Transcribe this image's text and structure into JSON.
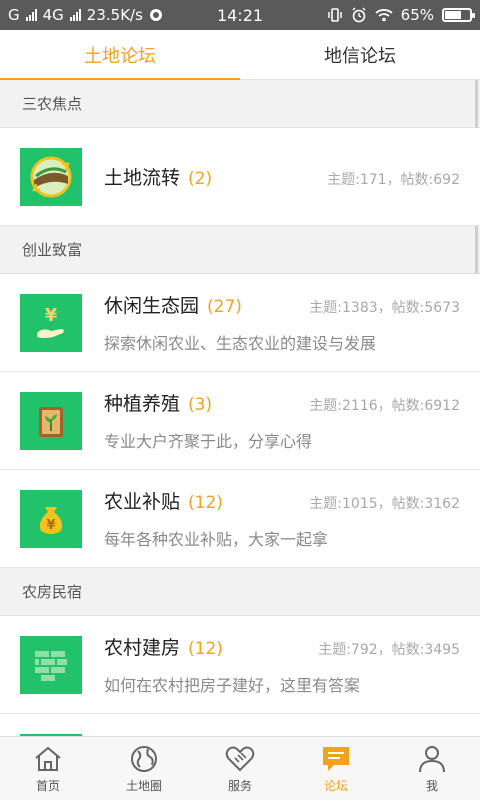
{
  "status": {
    "carrier1": "G",
    "carrier2": "4G",
    "speed": "23.5K/s",
    "time": "14:21",
    "battery": "65%",
    "battery_level": 0.65
  },
  "tabs": [
    {
      "label": "土地论坛",
      "active": true
    },
    {
      "label": "地信论坛",
      "active": false
    }
  ],
  "sections": [
    {
      "title": "三农焦点",
      "items": [
        {
          "name": "土地流转",
          "count": "(2)",
          "stats": "主题:171，帖数:692",
          "desc": "",
          "icon": "land-transfer-icon"
        }
      ]
    },
    {
      "title": "创业致富",
      "items": [
        {
          "name": "休闲生态园",
          "count": "(27)",
          "stats": "主题:1383，帖数:5673",
          "desc": "探索休闲农业、生态农业的建设与发展",
          "icon": "yuan-hand-icon"
        },
        {
          "name": "种植养殖",
          "count": "(3)",
          "stats": "主题:2116，帖数:6912",
          "desc": "专业大户齐聚于此，分享心得",
          "icon": "plant-book-icon"
        },
        {
          "name": "农业补贴",
          "count": "(12)",
          "stats": "主题:1015，帖数:3162",
          "desc": "每年各种农业补贴，大家一起拿",
          "icon": "money-bag-icon"
        }
      ]
    },
    {
      "title": "农房民宿",
      "items": [
        {
          "name": "农村建房",
          "count": "(12)",
          "stats": "主题:792，帖数:3495",
          "desc": "如何在农村把房子建好，这里有答案",
          "icon": "brick-wall-icon"
        }
      ]
    }
  ],
  "nav": [
    {
      "label": "首页",
      "icon": "home-icon",
      "active": false
    },
    {
      "label": "土地圈",
      "icon": "globe-icon",
      "active": false
    },
    {
      "label": "服务",
      "icon": "handshake-icon",
      "active": false
    },
    {
      "label": "论坛",
      "icon": "chat-icon",
      "active": true
    },
    {
      "label": "我",
      "icon": "person-icon",
      "active": false
    }
  ],
  "colors": {
    "accent": "#f5a11c",
    "green": "#22c26b"
  }
}
